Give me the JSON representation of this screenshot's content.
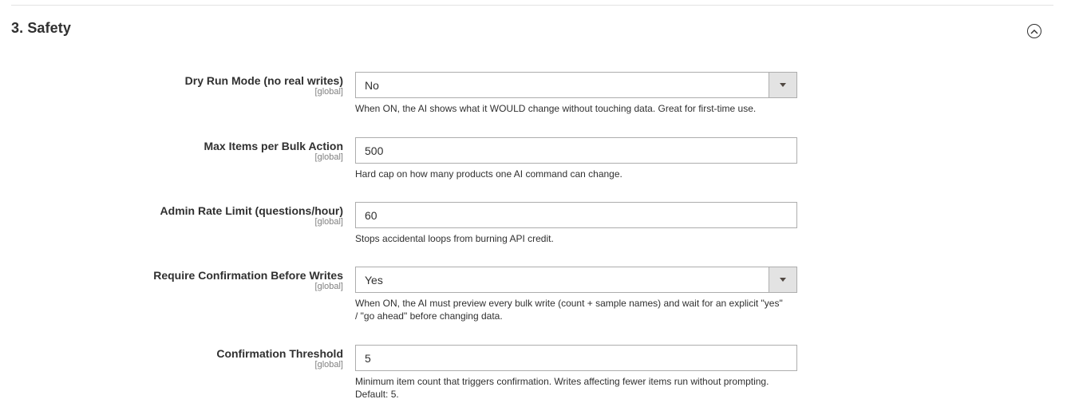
{
  "section": {
    "title": "3. Safety",
    "collapse_icon": "chevron-up-circle-icon"
  },
  "fields": [
    {
      "label": "Dry Run Mode (no real writes)",
      "scope": "[global]",
      "type": "select",
      "value": "No",
      "note": "When ON, the AI shows what it WOULD change without touching data. Great for first-time use."
    },
    {
      "label": "Max Items per Bulk Action",
      "scope": "[global]",
      "type": "text",
      "value": "500",
      "note": "Hard cap on how many products one AI command can change."
    },
    {
      "label": "Admin Rate Limit (questions/hour)",
      "scope": "[global]",
      "type": "text",
      "value": "60",
      "note": "Stops accidental loops from burning API credit."
    },
    {
      "label": "Require Confirmation Before Writes",
      "scope": "[global]",
      "type": "select",
      "value": "Yes",
      "note": "When ON, the AI must preview every bulk write (count + sample names) and wait for an explicit \"yes\" / \"go ahead\" before changing data."
    },
    {
      "label": "Confirmation Threshold",
      "scope": "[global]",
      "type": "text",
      "value": "5",
      "note": "Minimum item count that triggers confirmation. Writes affecting fewer items run without prompting. Default: 5."
    }
  ]
}
